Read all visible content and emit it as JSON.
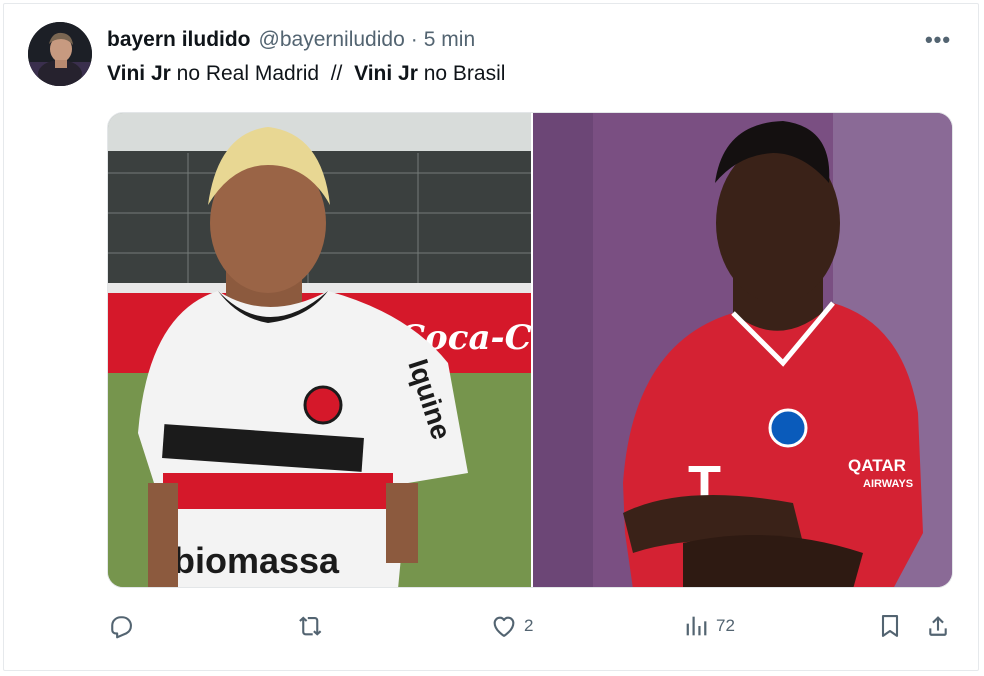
{
  "tweet": {
    "display_name": "bayern iludido",
    "handle": "@bayerniludido",
    "separator": "·",
    "time": "5 min",
    "more_label": "•••",
    "text": {
      "part1_bold": "Vini Jr",
      "part2": " no Real Madrid  //  ",
      "part3_bold": "Vini Jr",
      "part4": " no Brasil"
    }
  },
  "media": {
    "left_image": {
      "shirt_sponsor": "biomassa",
      "sleeve_text": "Iquine",
      "ad_board": "Coca-Cola"
    },
    "right_image": {
      "shirt_sponsor": "T",
      "sleeve_sponsor_line1": "QATAR",
      "sleeve_sponsor_line2": "AIRWAYS"
    }
  },
  "actions": {
    "reply_icon": "reply-icon",
    "retweet_icon": "retweet-icon",
    "like_icon": "heart-icon",
    "like_count": "2",
    "views_icon": "analytics-icon",
    "views_count": "72",
    "bookmark_icon": "bookmark-icon",
    "share_icon": "share-icon"
  },
  "colors": {
    "text_primary": "#0f1419",
    "text_secondary": "#536471",
    "border": "#e6e9ec"
  }
}
